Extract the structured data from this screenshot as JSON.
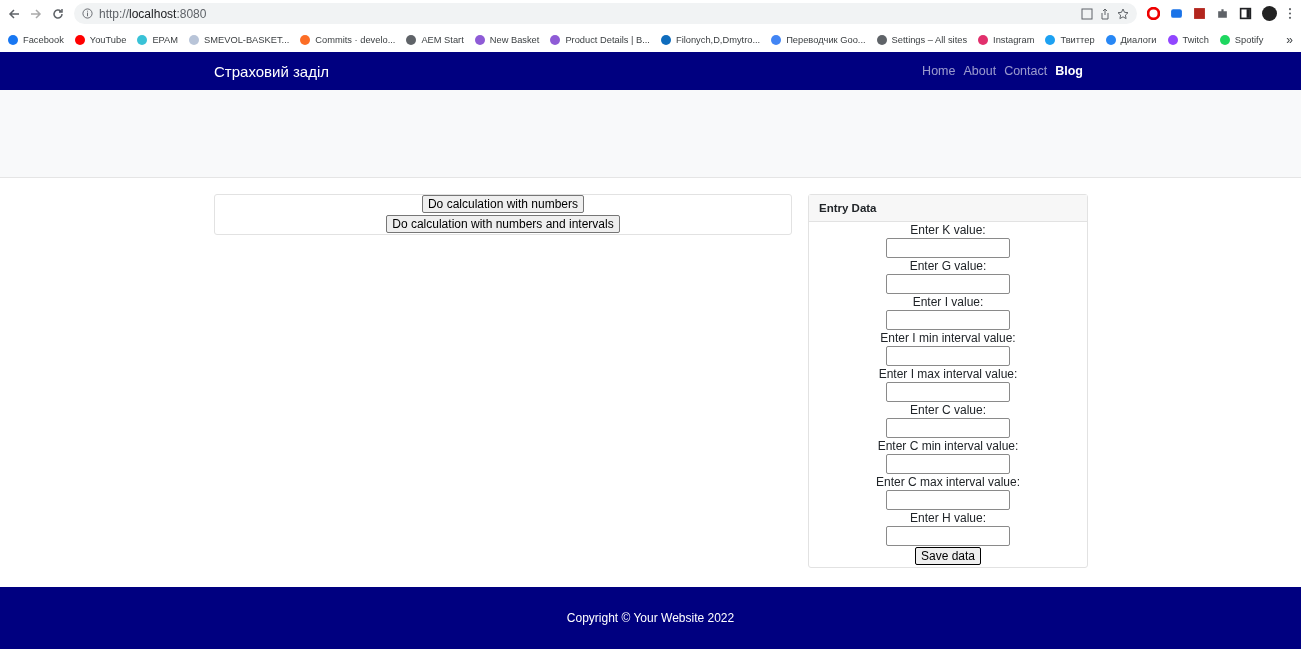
{
  "browser": {
    "url_prefix": "http://",
    "url_host": "localhost",
    "url_suffix": ":8080"
  },
  "bookmarks": [
    {
      "label": "Facebook",
      "color": "#1877f2"
    },
    {
      "label": "YouTube",
      "color": "#ff0000"
    },
    {
      "label": "EPAM",
      "color": "#39c2d7"
    },
    {
      "label": "SMEVOL-BASKET...",
      "color": "#b8c4d8"
    },
    {
      "label": "Commits · develo...",
      "color": "#fc6d26"
    },
    {
      "label": "AEM Start",
      "color": "#5f6368"
    },
    {
      "label": "New Basket",
      "color": "#8e5bd6"
    },
    {
      "label": "Product Details | B...",
      "color": "#8e5bd6"
    },
    {
      "label": "Filonych,D,Dmytro...",
      "color": "#0f6cbd"
    },
    {
      "label": "Переводчик Goo...",
      "color": "#4285f4"
    },
    {
      "label": "Settings – All sites",
      "color": "#5f6368"
    },
    {
      "label": "Instagram",
      "color": "#e1306c"
    },
    {
      "label": "Твиттер",
      "color": "#1da1f2"
    },
    {
      "label": "Диалоги",
      "color": "#2787f5"
    },
    {
      "label": "Twitch",
      "color": "#9146ff"
    },
    {
      "label": "Spotify",
      "color": "#1ed760"
    }
  ],
  "bookmarks_more": "»",
  "navbar": {
    "brand": "Страховий заділ",
    "links": [
      {
        "label": "Home",
        "selected": false
      },
      {
        "label": "About",
        "selected": false
      },
      {
        "label": "Contact",
        "selected": false
      },
      {
        "label": "Blog",
        "selected": true
      }
    ]
  },
  "actions": [
    "Do calculation with numbers",
    "Do calculation with numbers and intervals"
  ],
  "entry": {
    "title": "Entry Data",
    "fields": [
      "Enter K value:",
      "Enter G value:",
      "Enter I value:",
      "Enter I min interval value:",
      "Enter I max interval value:",
      "Enter C value:",
      "Enter C min interval value:",
      "Enter C max interval value:",
      "Enter H value:"
    ],
    "button": "Save data"
  },
  "footer": "Copyright © Your Website 2022"
}
